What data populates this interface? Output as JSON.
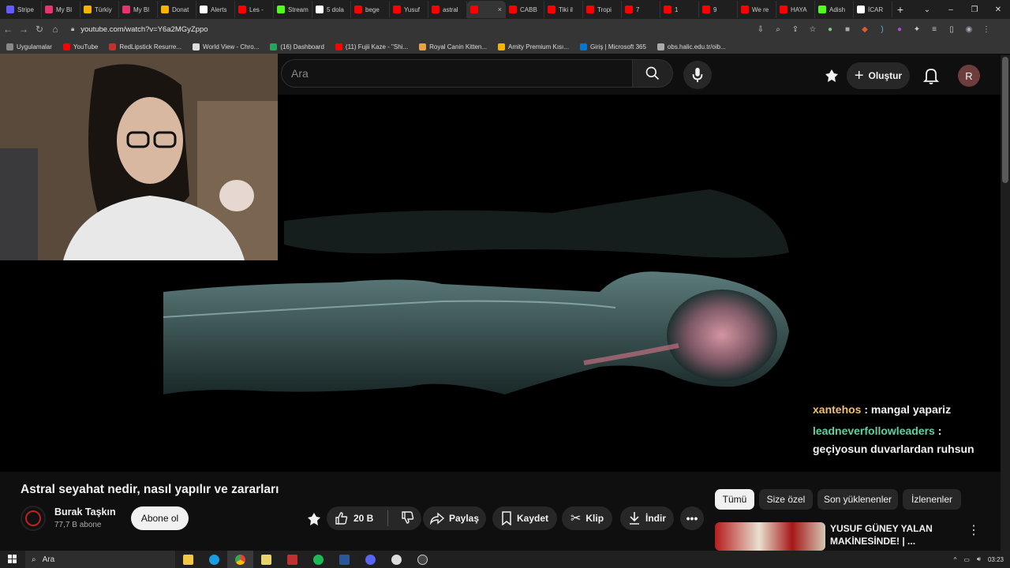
{
  "browser": {
    "tabs": [
      {
        "label": "Stripe",
        "color": "#635bff"
      },
      {
        "label": "My Bl",
        "color": "#e8336d"
      },
      {
        "label": "Türkiy",
        "color": "#f6b400"
      },
      {
        "label": "My Bl",
        "color": "#e8336d"
      },
      {
        "label": "Donat",
        "color": "#f6b400"
      },
      {
        "label": "Alerts",
        "color": "#ffffff"
      },
      {
        "label": "Les -",
        "color": "#ff0000"
      },
      {
        "label": "Stream",
        "color": "#53fc18"
      },
      {
        "label": "5 dola",
        "color": "#ffffff"
      },
      {
        "label": "bege",
        "color": "#ff0000"
      },
      {
        "label": "Yusuf",
        "color": "#ff0000"
      },
      {
        "label": "astral",
        "color": "#ff0000"
      },
      {
        "label": "",
        "color": "#ff0000"
      },
      {
        "label": "CABB",
        "color": "#ff0000"
      },
      {
        "label": "Tiki il",
        "color": "#ff0000"
      },
      {
        "label": "Tropi",
        "color": "#ff0000"
      },
      {
        "label": "7",
        "color": "#ff0000"
      },
      {
        "label": "1",
        "color": "#ff0000"
      },
      {
        "label": "9",
        "color": "#ff0000"
      },
      {
        "label": "We re",
        "color": "#ff0000"
      },
      {
        "label": "HAYA",
        "color": "#ff0000"
      },
      {
        "label": "Adish",
        "color": "#53fc18"
      },
      {
        "label": "İCAR",
        "color": "#ffffff"
      }
    ],
    "new_tab_label": "+",
    "url": "youtube.com/watch?v=Y6a2MGyZppo",
    "bookmarks": [
      {
        "label": "Uygulamalar",
        "color": "#888888"
      },
      {
        "label": "YouTube",
        "color": "#ff0000"
      },
      {
        "label": "RedLipstick Resurre...",
        "color": "#c4302b"
      },
      {
        "label": "World View - Chro...",
        "color": "#dddddd"
      },
      {
        "label": "(16) Dashboard",
        "color": "#23a55a"
      },
      {
        "label": "(11) Fujii Kaze - \"Shi...",
        "color": "#ff0000"
      },
      {
        "label": "Royal Canin Kitten...",
        "color": "#e8a33d"
      },
      {
        "label": "Amity Premium Kısı...",
        "color": "#f6b400"
      },
      {
        "label": "Giriş | Microsoft 365",
        "color": "#0078d4"
      },
      {
        "label": "obs.halic.edu.tr/oib...",
        "color": "#aaaaaa"
      }
    ]
  },
  "youtube": {
    "search_placeholder": "Ara",
    "create_label": "Oluştur",
    "avatar_letter": "R",
    "video": {
      "title": "Astral seyahat nedir, nasıl yapılır ve zararları",
      "channel": "Burak Taşkın",
      "subscribers": "77,7 B abone",
      "subscribe_label": "Abone ol",
      "likes": "20 B",
      "share_label": "Paylaş",
      "save_label": "Kaydet",
      "clip_label": "Klip",
      "download_label": "İndir"
    },
    "chips": [
      "Tümü",
      "Size özel",
      "Son yüklenenler",
      "İzlenenler"
    ],
    "recommendation": {
      "title": "YUSUF GÜNEY YALAN MAKİNESİNDE! | ..."
    }
  },
  "stream_chat": [
    {
      "user": "xantehos",
      "user_color": "#f0c070",
      "message": "mangal yapariz"
    },
    {
      "user": "leadneverfollowleaders",
      "user_color": "#5fd1a0",
      "message": "geçiyosun duvarlardan ruhsun"
    }
  ],
  "taskbar": {
    "search_label": "Ara",
    "time": "03:23"
  }
}
